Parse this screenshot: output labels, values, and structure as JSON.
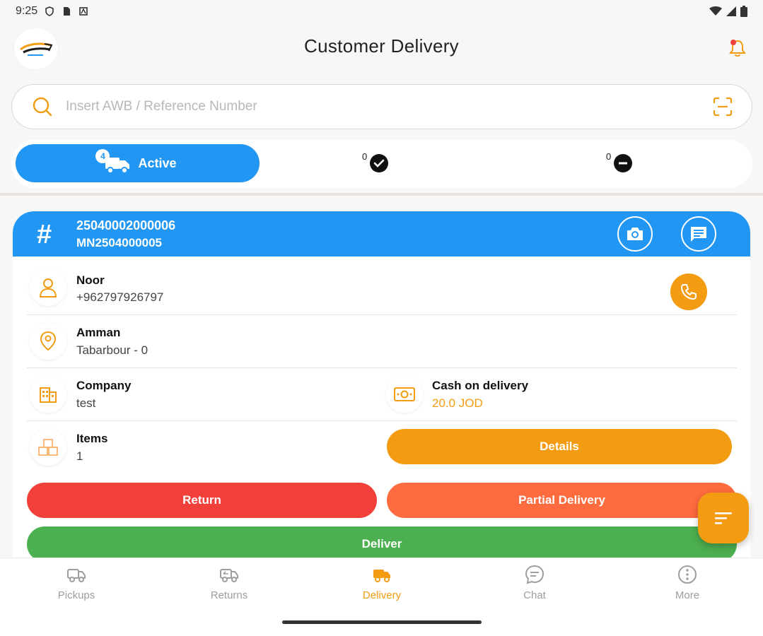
{
  "status_bar": {
    "time": "9:25"
  },
  "header": {
    "title": "Customer Delivery"
  },
  "search": {
    "placeholder": "Insert AWB / Reference Number",
    "value": ""
  },
  "tabs": {
    "active": {
      "label": "Active",
      "count": "4"
    },
    "delivered": {
      "count": "0"
    },
    "cancelled": {
      "count": "0"
    }
  },
  "shipment": {
    "awb": "25040002000006",
    "reference": "MN2504000005",
    "customer": {
      "name": "Noor",
      "phone": "+962797926797"
    },
    "location": {
      "city": "Amman",
      "area": "Tabarbour - 0"
    },
    "company": {
      "label": "Company",
      "value": "test"
    },
    "cod": {
      "label": "Cash on delivery",
      "value": "20.0 JOD"
    },
    "items": {
      "label": "Items",
      "value": "1"
    }
  },
  "actions": {
    "details": "Details",
    "return": "Return",
    "partial": "Partial Delivery",
    "deliver": "Deliver"
  },
  "nav": [
    {
      "label": "Pickups",
      "icon": "pickup-truck-icon"
    },
    {
      "label": "Returns",
      "icon": "return-truck-icon"
    },
    {
      "label": "Delivery",
      "icon": "delivery-truck-icon",
      "active": true
    },
    {
      "label": "Chat",
      "icon": "chat-icon"
    },
    {
      "label": "More",
      "icon": "more-icon"
    }
  ],
  "colors": {
    "primary": "#2196f3",
    "accent": "#f39c12",
    "return": "#f1403a",
    "partial": "#fd6b3e",
    "deliver": "#4caf50"
  }
}
